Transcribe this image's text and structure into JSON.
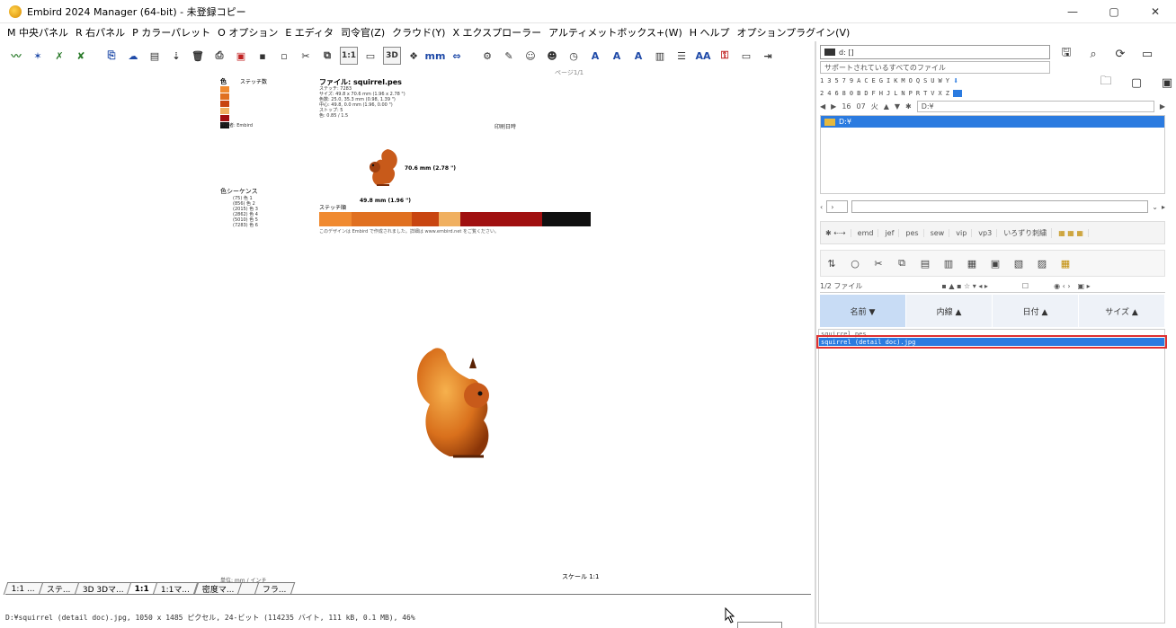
{
  "window": {
    "title": "Embird 2024 Manager (64-bit) - 未登録コピー",
    "minimize": "—",
    "maximize": "▢",
    "close": "✕"
  },
  "menu": [
    "M 中央パネル",
    "R 右パネル",
    "P カラーパレット",
    "O オプション",
    "E エディタ",
    "司令官(Z)",
    "クラウド(Y)",
    "X エクスプローラー",
    "アルティメットボックス+(W)",
    "H ヘルプ",
    "オプションプラグイン(V)"
  ],
  "toolbar": {
    "scale_1_1": "1:1",
    "view_3d": "3D",
    "unit_mm": "mm",
    "text_a1": "A",
    "text_a2": "A",
    "text_a3": "A",
    "text_aa": "AA"
  },
  "document": {
    "corner_label": "ページ1/1",
    "color_header": "色",
    "stitch_header": "ステッチ数",
    "file_title": "ファイル: squirrel.pes",
    "meta": [
      "ステッチ: 7283",
      "サイズ: 49.8 x 70.6 mm (1.96 x 2.78 \")",
      "色数: 25.0, 35.3 mm (0.98, 1.39 \")",
      "中心: 49.8, 0.0 mm (1.96, 0.00 \")",
      "ストップ: 5",
      "色: 0.85 / 1.5"
    ],
    "author": "作成者: Embird",
    "stamp": "印刷日時",
    "height_label": "70.6 mm (2.78 \")",
    "width_label": "49.8 mm (1.96 \")",
    "sequence_title": "色シーケンス",
    "sequence": [
      "(75) 色 1",
      "(856) 色 2",
      "(2015) 色 3",
      "(2862) 色 4",
      "(5010) 色 5",
      "(7283) 色 6"
    ],
    "color_bar_label": "ステッチ順",
    "footnote": "このデザインは Embird で作成されました。詳細は www.embird.net をご覧ください。",
    "colors": [
      "#f08a30",
      "#e07020",
      "#c84510",
      "#f0b060",
      "#a01010",
      "#101010"
    ],
    "scale_label": "スケール 1:1",
    "unit_label": "単位: mm / インチ"
  },
  "tabs": [
    "1:1 ...",
    "ステ...",
    "3D 3Dマ...",
    "1:1",
    "1:1マ...",
    "密度マ...",
    "",
    "フラ..."
  ],
  "status": "D:¥squirrel (detail doc).jpg, 1050 x 1485 ピクセル, 24-ビット (114235 バイト, 111 kB, 0.1 MB), 46%",
  "right": {
    "drive": "d: []",
    "filter": "サポートされているすべてのファイル",
    "alpha_row1": [
      "1",
      "3",
      "5",
      "7",
      "9",
      "A",
      "C",
      "E",
      "G",
      "I",
      "K",
      "M",
      "O",
      "Q",
      "S",
      "U",
      "W",
      "Y"
    ],
    "alpha_row2": [
      "2",
      "4",
      "6",
      "8",
      "0",
      "B",
      "D",
      "F",
      "H",
      "J",
      "L",
      "N",
      "P",
      "R",
      "T",
      "V",
      "X",
      "Z"
    ],
    "nav": [
      "16",
      "07",
      "火"
    ],
    "path": "D:¥",
    "tree_item": "D:¥",
    "file_types": [
      "emd",
      "jef",
      "pes",
      "sew",
      "vip",
      "vp3",
      "いろずり刺繍"
    ],
    "count": "1/2 ファイル",
    "sort": [
      "名前 ▼",
      "内線 ▲",
      "日付 ▲",
      "サイズ ▲"
    ],
    "files": [
      "squirrel.pes",
      "squirrel (detail doc).jpg"
    ]
  }
}
